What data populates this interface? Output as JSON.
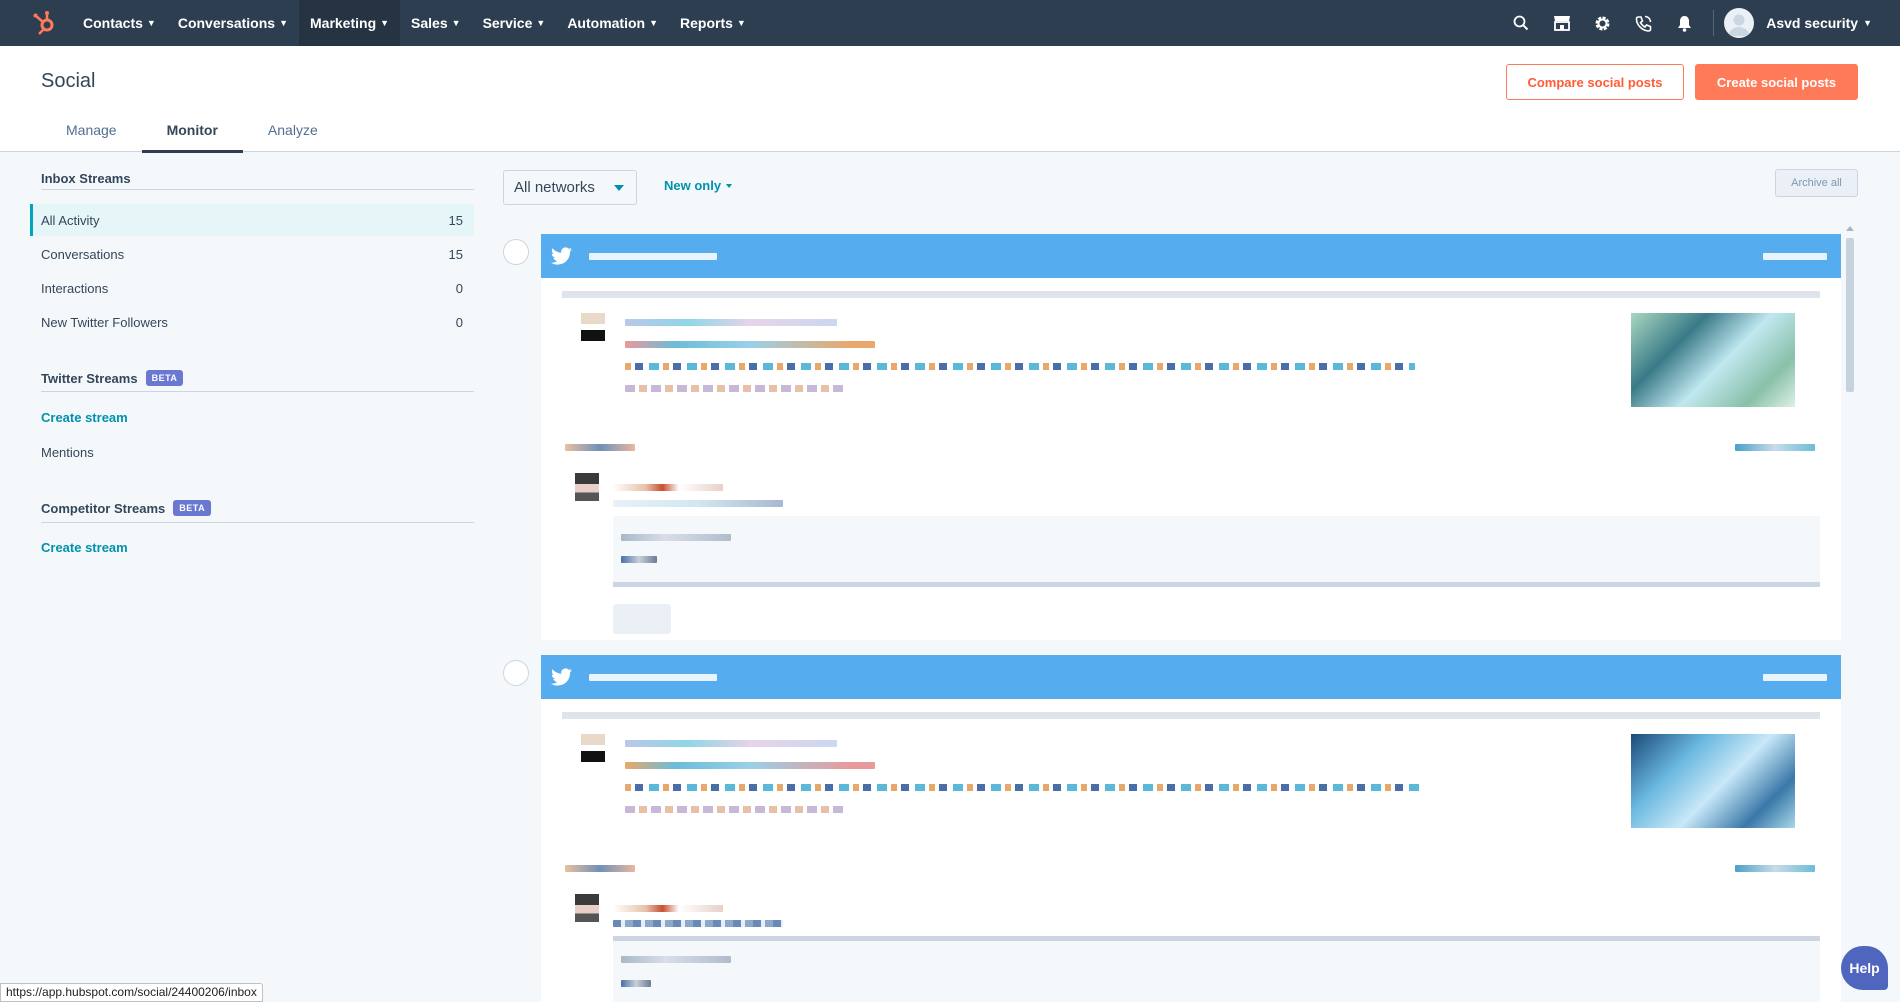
{
  "nav": {
    "items": [
      {
        "label": "Contacts"
      },
      {
        "label": "Conversations"
      },
      {
        "label": "Marketing"
      },
      {
        "label": "Sales"
      },
      {
        "label": "Service"
      },
      {
        "label": "Automation"
      },
      {
        "label": "Reports"
      }
    ],
    "account_name": "Asvd security",
    "icons": [
      "search-icon",
      "marketplace-icon",
      "settings-icon",
      "calling-icon",
      "notifications-icon"
    ]
  },
  "header": {
    "title": "Social",
    "tabs": [
      {
        "label": "Manage"
      },
      {
        "label": "Monitor"
      },
      {
        "label": "Analyze"
      }
    ],
    "compare_button": "Compare social posts",
    "create_button": "Create social posts"
  },
  "sidebar": {
    "inbox_title": "Inbox Streams",
    "inbox_streams": [
      {
        "label": "All Activity",
        "count": "15"
      },
      {
        "label": "Conversations",
        "count": "15"
      },
      {
        "label": "Interactions",
        "count": "0"
      },
      {
        "label": "New Twitter Followers",
        "count": "0"
      }
    ],
    "twitter_title": "Twitter Streams",
    "twitter_badge": "BETA",
    "twitter_create": "Create stream",
    "twitter_mentions": "Mentions",
    "competitor_title": "Competitor Streams",
    "competitor_badge": "BETA",
    "competitor_create": "Create stream"
  },
  "toolbar": {
    "network_filter": "All networks",
    "new_only": "New only",
    "archive_all": "Archive all"
  },
  "status_url": "https://app.hubspot.com/social/24400206/inbox",
  "help_label": "Help",
  "colors": {
    "nav_bg": "#2d3e50",
    "accent": "#ff7a59",
    "link": "#0091ae",
    "twitter_blue": "#55acee",
    "beta_badge": "#6a78d1"
  }
}
